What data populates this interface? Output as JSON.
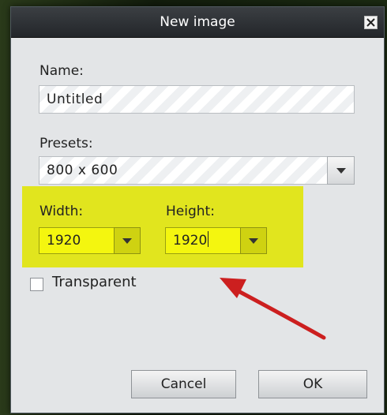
{
  "dialog": {
    "title": "New image",
    "close_icon": "close-icon"
  },
  "name": {
    "label": "Name:",
    "value": "Untitled"
  },
  "presets": {
    "label": "Presets:",
    "selected": "800 x 600",
    "dropdown_icon": "chevron-down-icon"
  },
  "width": {
    "label": "Width:",
    "value": "1920"
  },
  "height": {
    "label": "Height:",
    "value": "1920"
  },
  "transparent": {
    "label": "Transparent",
    "checked": false
  },
  "buttons": {
    "cancel": "Cancel",
    "ok": "OK"
  },
  "colors": {
    "highlight": "#e1e51e",
    "annotation_arrow": "#cc1f1f",
    "titlebar": "#2b2f33"
  }
}
